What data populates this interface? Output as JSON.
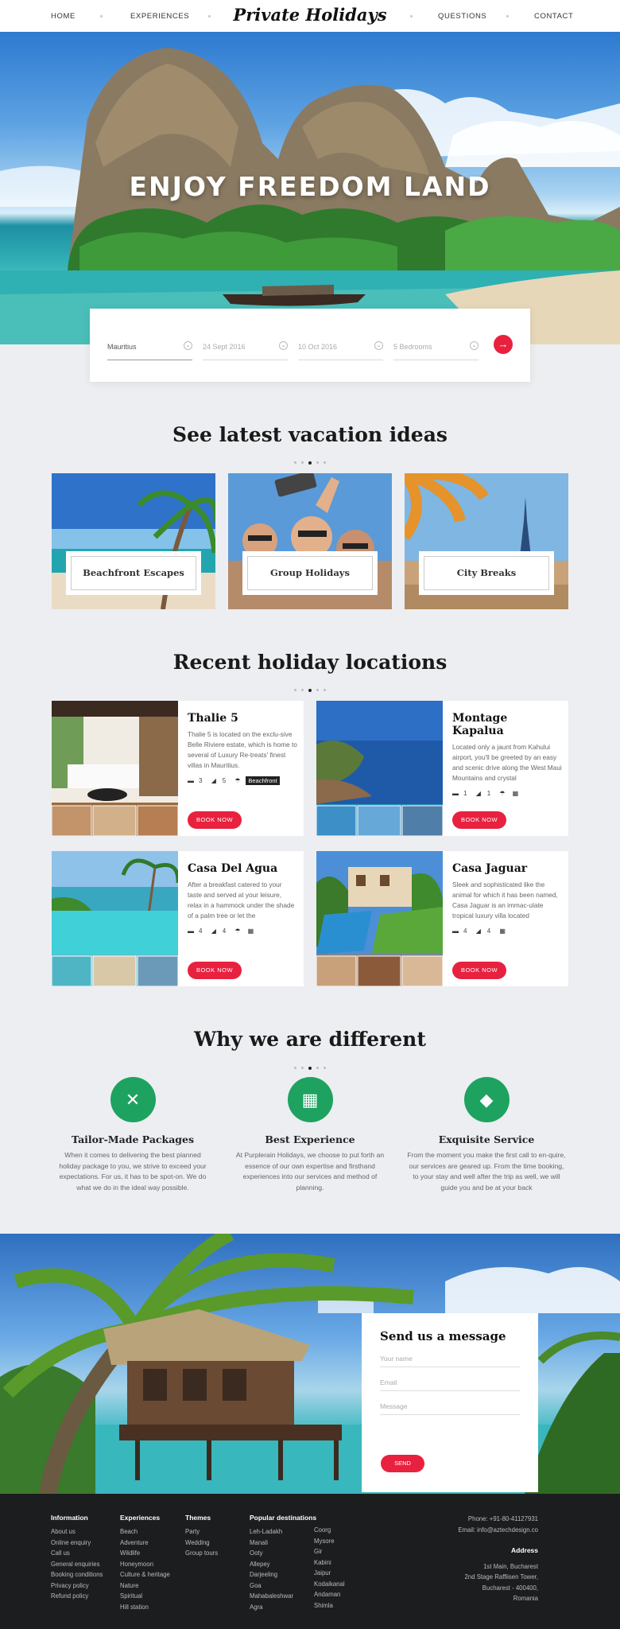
{
  "nav": {
    "items": [
      "HOME",
      "EXPERIENCES",
      "QUESTIONS",
      "CONTACT"
    ],
    "logo": "Private Holidays"
  },
  "hero": {
    "title": "ENJOY FREEDOM LAND"
  },
  "search": {
    "destination": "Mauritius",
    "check_in": "24 Sept 2016",
    "check_out": "10 Oct 2016",
    "bedrooms": "5 Bedrooms",
    "go_icon": "arrow-right-icon"
  },
  "ideas": {
    "title": "See latest vacation ideas",
    "cards": [
      "Beachfront Escapes",
      "Group Holidays",
      "City Breaks"
    ]
  },
  "locations": {
    "title": "Recent holiday locations",
    "cards": [
      {
        "name": "Thalie 5",
        "desc": "Thalie 5 is located on the exclu-sive Belle Riviere estate, which is home to several of Luxury Re-treats' finest villas in Mauritius.",
        "beds": "3",
        "baths": "5",
        "tag": "Beachfront",
        "button": "BOOK NOW"
      },
      {
        "name": "Montage Kapalua",
        "desc": "Located only a jaunt from Kahului airport, you'll be greeted by an easy and scenic drive along the West Maui Mountains and crystal",
        "beds": "1",
        "baths": "1",
        "button": "BOOK NOW"
      },
      {
        "name": "Casa Del Agua",
        "desc": "After a breakfast catered to your taste and served at your leisure, relax in a hammock under the shade of a palm tree or let the",
        "beds": "4",
        "baths": "4",
        "button": "BOOK NOW"
      },
      {
        "name": "Casa Jaguar",
        "desc": "Sleek and sophisticated like the animal for which it has been named, Casa Jaguar is an immac-ulate tropical luxury villa located",
        "beds": "4",
        "baths": "4",
        "button": "BOOK NOW"
      }
    ]
  },
  "why": {
    "title": "Why we are different",
    "items": [
      {
        "icon": "handshake-icon",
        "title": "Tailor-Made Packages",
        "desc": "When it comes to delivering the best planned holiday package to you, we strive to exceed your expectations. For us, it has to be spot-on. We do what we do in the ideal way possible."
      },
      {
        "icon": "calendar-check-icon",
        "title": "Best Experience",
        "desc": "At Purplerain Holidays, we choose to put forth an essence of our own expertise and firsthand experiences into our services and method of planning."
      },
      {
        "icon": "diamond-icon",
        "title": "Exquisite Service",
        "desc": "From the moment you make the first call to en-quire, our services are geared up. From the time booking, to your stay and well after the trip as well, we will guide you and be at your back"
      }
    ]
  },
  "contact": {
    "title": "Send us a message",
    "name_placeholder": "Your name",
    "email_placeholder": "Email",
    "message_placeholder": "Message",
    "send": "SEND"
  },
  "footer": {
    "information": {
      "title": "Information",
      "links": [
        "About us",
        "Online enquiry",
        "Call us",
        "General enquiries",
        "Booking conditions",
        "Privacy policy",
        "Refund policy"
      ]
    },
    "experiences": {
      "title": "Experiences",
      "links": [
        "Beach",
        "Adventure",
        "Wildlife",
        "Honeymoon",
        "Culture & heritage",
        "Nature",
        "Spiritual",
        "Hill station"
      ]
    },
    "themes": {
      "title": "Themes",
      "links": [
        "Party",
        "Wedding",
        "Group tours"
      ]
    },
    "destinations": {
      "title": "Popular destinations",
      "col1": [
        "Leh-Ladakh",
        "Manali",
        "Ooty",
        "Allepey",
        "Darjeeling",
        "Goa",
        "Mahabaleshwar",
        "Agra"
      ],
      "col2": [
        "Coorg",
        "Mysore",
        "Gir",
        "Kabini",
        "Jaipur",
        "Kodaikanal",
        "Andaman",
        "Shimla"
      ]
    },
    "phone": "Phone: +91-80-41127931",
    "email": "Email: info@aztechdesign.co",
    "address_title": "Address",
    "address": [
      "1st Main, Bucharest",
      "2nd Stage Raffiisen Tower,",
      "Bucharest - 400400,",
      "Romania"
    ]
  },
  "colors": {
    "accent": "#e8213f",
    "green": "#1ea260",
    "footer": "#1c1d1f"
  }
}
